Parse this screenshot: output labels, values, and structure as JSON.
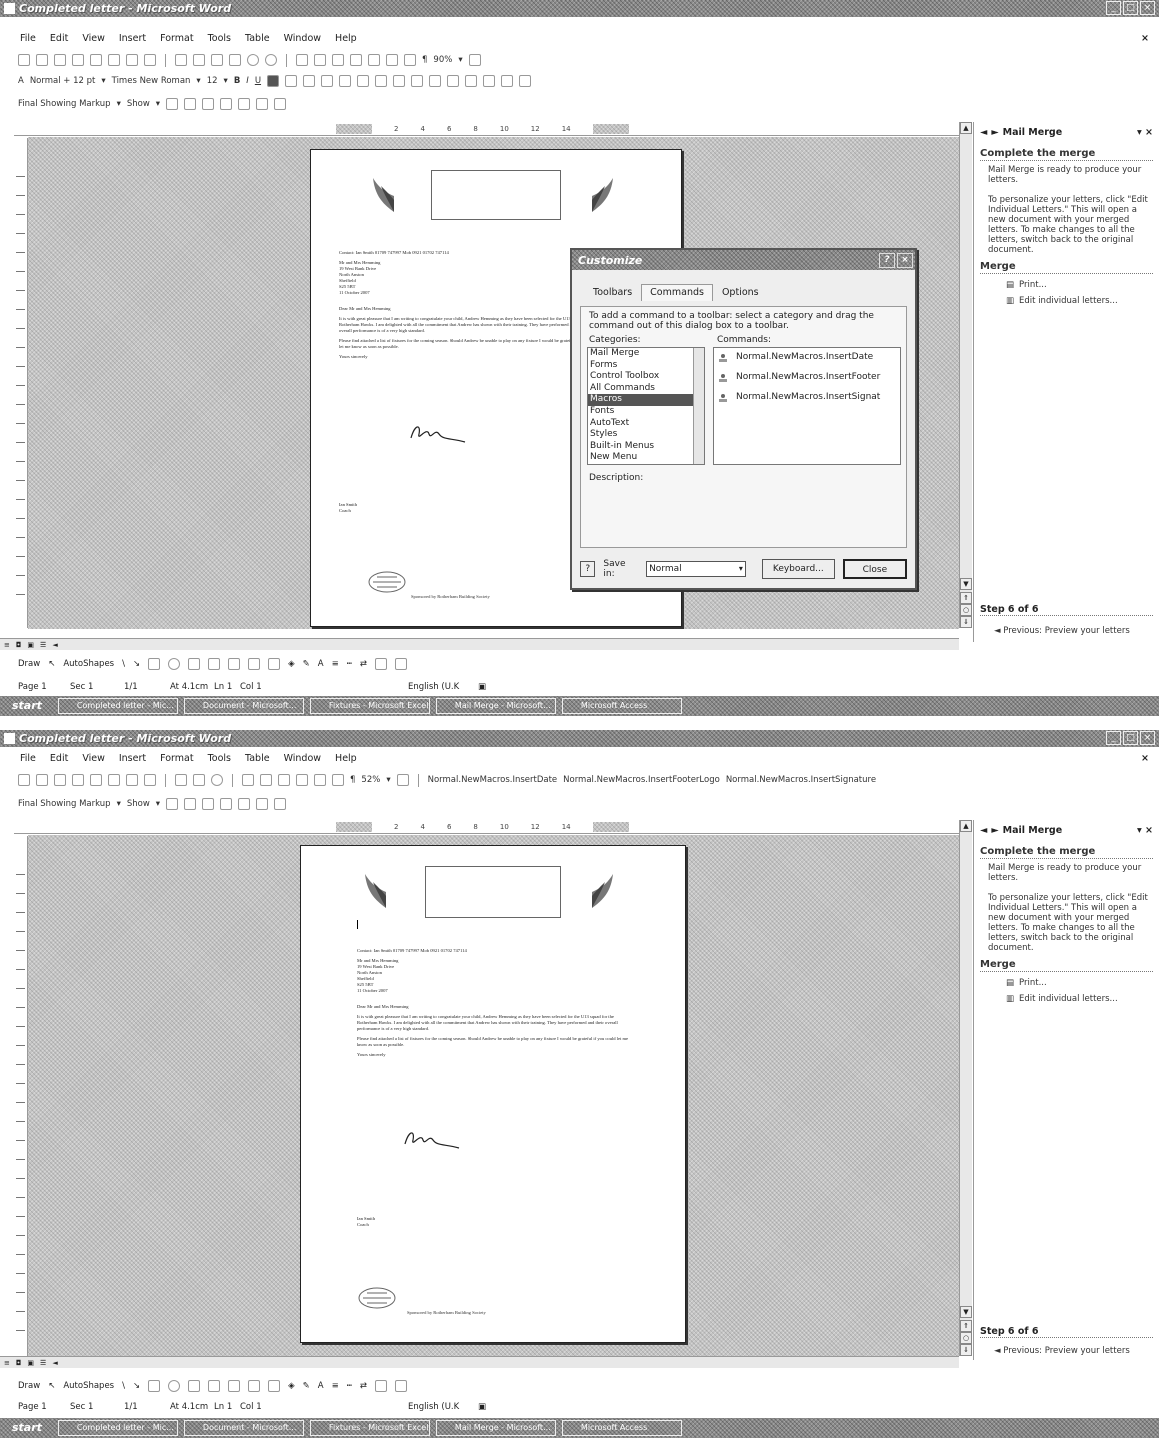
{
  "window": {
    "title": "Completed letter - Microsoft Word",
    "controls": [
      "_",
      "□",
      "×"
    ]
  },
  "menu": [
    "File",
    "Edit",
    "View",
    "Insert",
    "Format",
    "Tools",
    "Table",
    "Window",
    "Help"
  ],
  "formatting": {
    "style": "Normal + 12 pt",
    "font": "Times New Roman",
    "size": "12",
    "bold": "B",
    "italic": "I",
    "underline": "U"
  },
  "zoom_top": "90%",
  "zoom_bottom": "52%",
  "reviewing": {
    "mode": "Final Showing Markup",
    "show": "Show"
  },
  "custom_toolbar": [
    "Normal.NewMacros.InsertDate",
    "Normal.NewMacros.InsertFooterLogo",
    "Normal.NewMacros.InsertSignature"
  ],
  "ruler_ticks": [
    "1",
    "2",
    "4",
    "6",
    "8",
    "10",
    "12",
    "14",
    "16",
    "18"
  ],
  "letter": {
    "contact": "Contact:   Ian Smith 01709 747997 Mob 0921 01702 747114",
    "address": [
      "Mr and Mrs Hemming",
      "19 West Bank Drive",
      "North Anston",
      "Sheffield",
      "S25 5BT",
      "11 October 2007"
    ],
    "salutation": "Dear Mr and Mrs Hemming",
    "para1": "It is with great pleasure that I am writing to congratulate your child, Andrew Hemming as they have been selected for the U13 squad for the Rotherham Hawks. I am delighted with all the commitment that Andrew has shown with their training. They have performed and their overall performance is of a very high standard.",
    "para2": "Please find attached a list of fixtures for the coming season. Should Andrew be unable to play on any fixture I would be grateful if you could let me know as soon as possible.",
    "closing": "Yours sincerely",
    "name": "Ian Smith",
    "role": "Coach",
    "footer": "Sponsored by Rotherham Building Society"
  },
  "mail_merge": {
    "title": "Mail Merge",
    "section": "Complete the merge",
    "ready": "Mail Merge is ready to produce your letters.",
    "personalize": "To personalize your letters, click \"Edit Individual Letters.\" This will open a new document with your merged letters. To make changes to all the letters, switch back to the original document.",
    "merge_heading": "Merge",
    "print": "Print...",
    "edit": "Edit individual letters...",
    "step": "Step 6 of 6",
    "previous": "Previous: Preview your letters"
  },
  "dialog": {
    "title": "Customize",
    "tabs": [
      "Toolbars",
      "Commands",
      "Options"
    ],
    "instructions": "To add a command to a toolbar: select a category and drag the command out of this dialog box to a toolbar.",
    "categories_label": "Categories:",
    "commands_label": "Commands:",
    "categories": [
      "Mail Merge",
      "Forms",
      "Control Toolbox",
      "All Commands",
      "Macros",
      "Fonts",
      "AutoText",
      "Styles",
      "Built-in Menus",
      "New Menu"
    ],
    "commands": [
      "Normal.NewMacros.InsertDate",
      "Normal.NewMacros.InsertFooter",
      "Normal.NewMacros.InsertSignat"
    ],
    "description_label": "Description:",
    "save_in_label": "Save in:",
    "save_in_value": "Normal",
    "keyboard": "Keyboard...",
    "close": "Close",
    "help": "?"
  },
  "draw": {
    "draw": "Draw",
    "autoshapes": "AutoShapes"
  },
  "status": {
    "page": "Page 1",
    "sec": "Sec 1",
    "pages": "1/1",
    "at": "At 4.1cm",
    "ln": "Ln 1",
    "col": "Col 1",
    "lang": "English (U.K"
  },
  "taskbar": {
    "start": "start",
    "tasks": [
      "Completed letter - Mic...",
      "Document - Microsoft...",
      "Fixtures - Microsoft Excel",
      "Mail Merge - Microsoft...",
      "Microsoft Access"
    ]
  }
}
